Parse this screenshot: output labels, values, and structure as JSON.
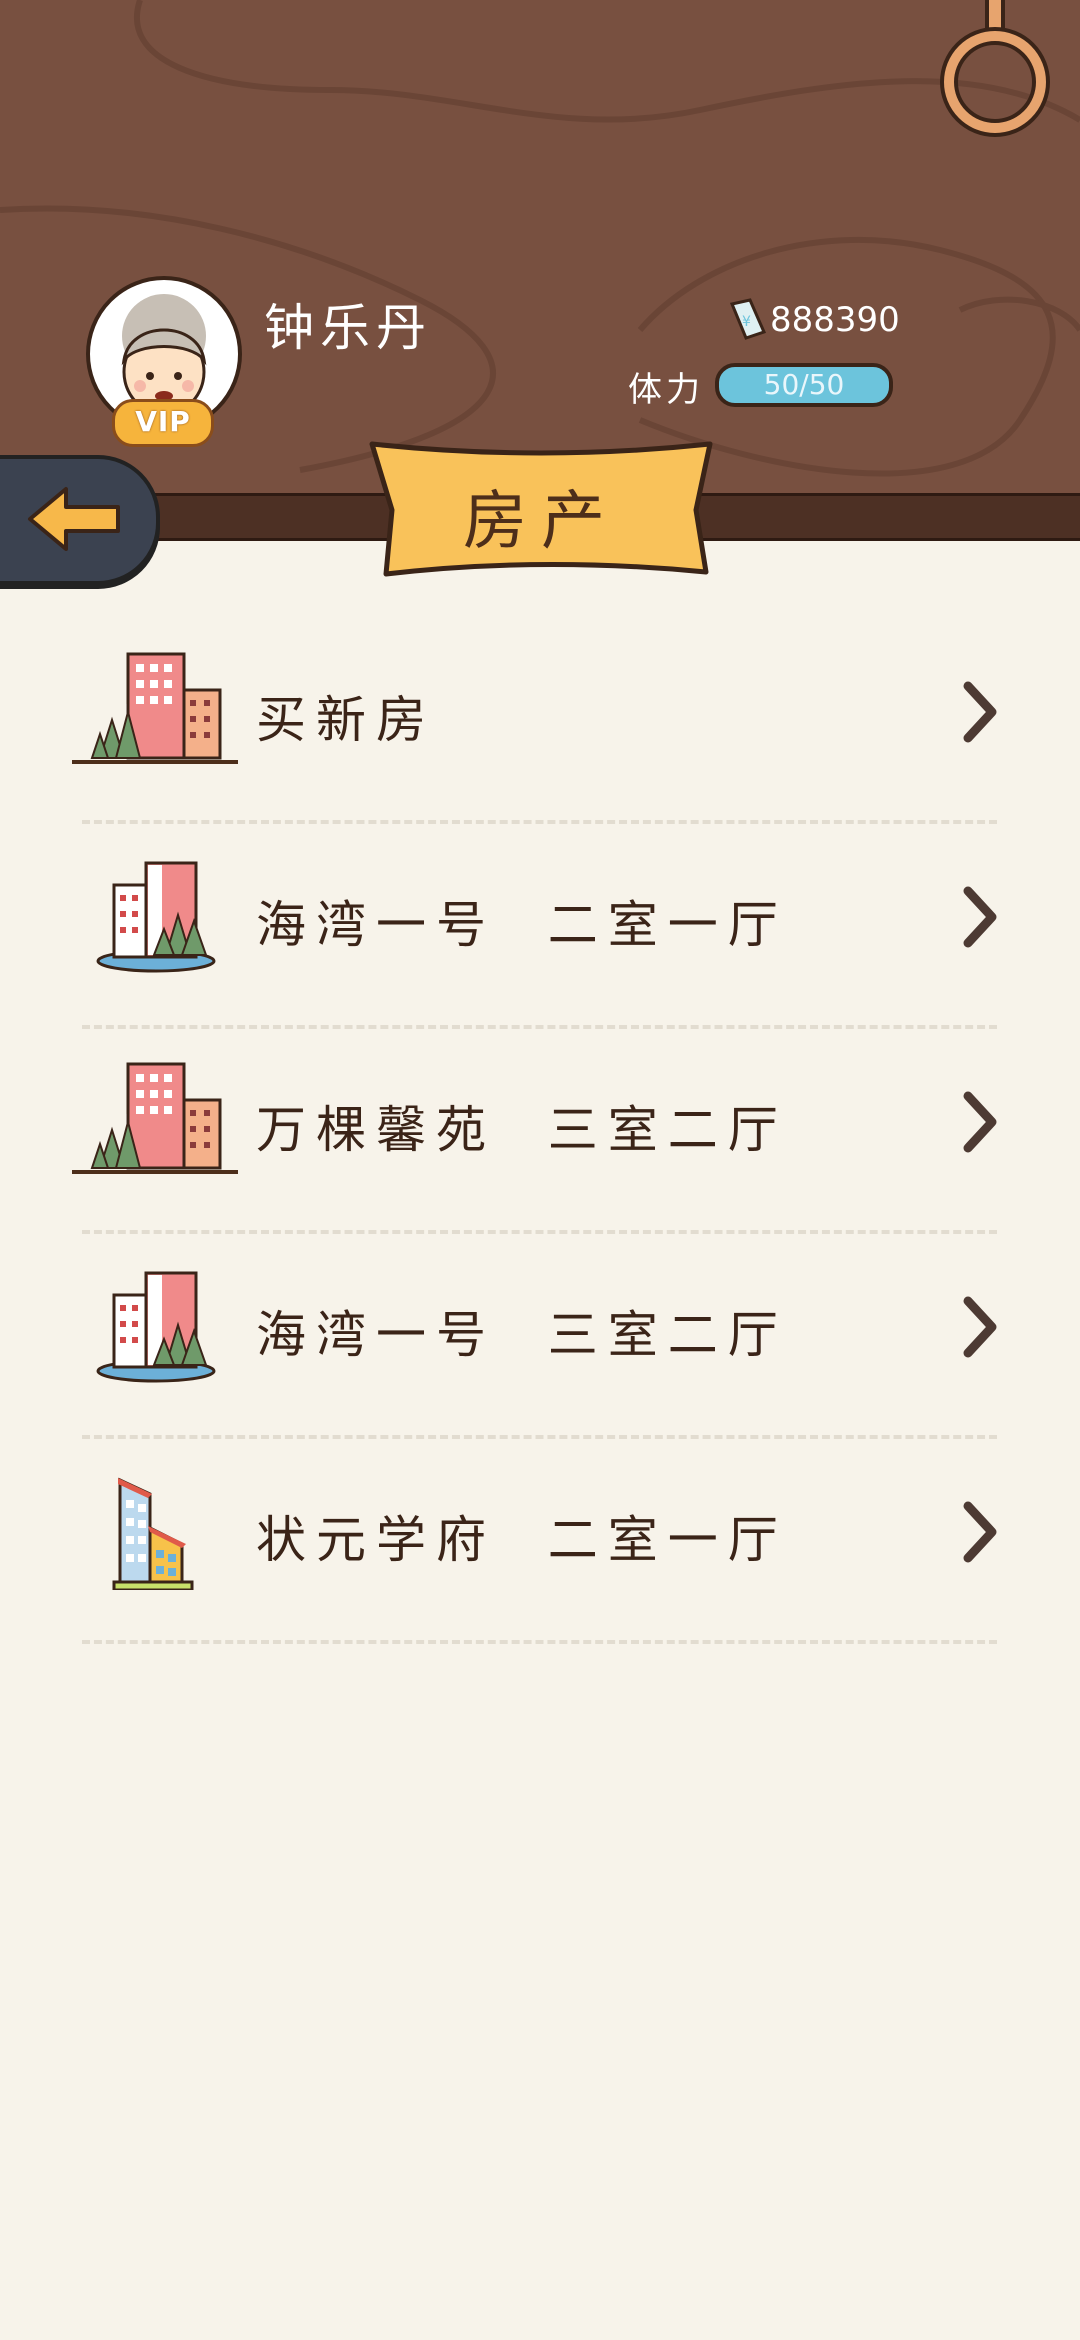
{
  "player": {
    "name": "钟乐丹",
    "vip_label": "VIP",
    "money": "888390",
    "stamina_label": "体力",
    "stamina": "50/50",
    "stamina_fraction": 1.0
  },
  "page": {
    "title": "房产"
  },
  "houses": [
    {
      "label": "买新房",
      "icon": "city-buildings-icon"
    },
    {
      "label": "海湾一号  二室一厅",
      "icon": "seaside-buildings-icon"
    },
    {
      "label": "万棵馨苑  三室二厅",
      "icon": "city-buildings-icon"
    },
    {
      "label": "海湾一号  三室二厅",
      "icon": "seaside-buildings-icon"
    },
    {
      "label": "状元学府  二室一厅",
      "icon": "tower-buildings-icon"
    }
  ],
  "colors": {
    "header": "#785040",
    "background": "#f7f3ea",
    "banner": "#f9c25a",
    "stamina": "#6cc4dc"
  }
}
